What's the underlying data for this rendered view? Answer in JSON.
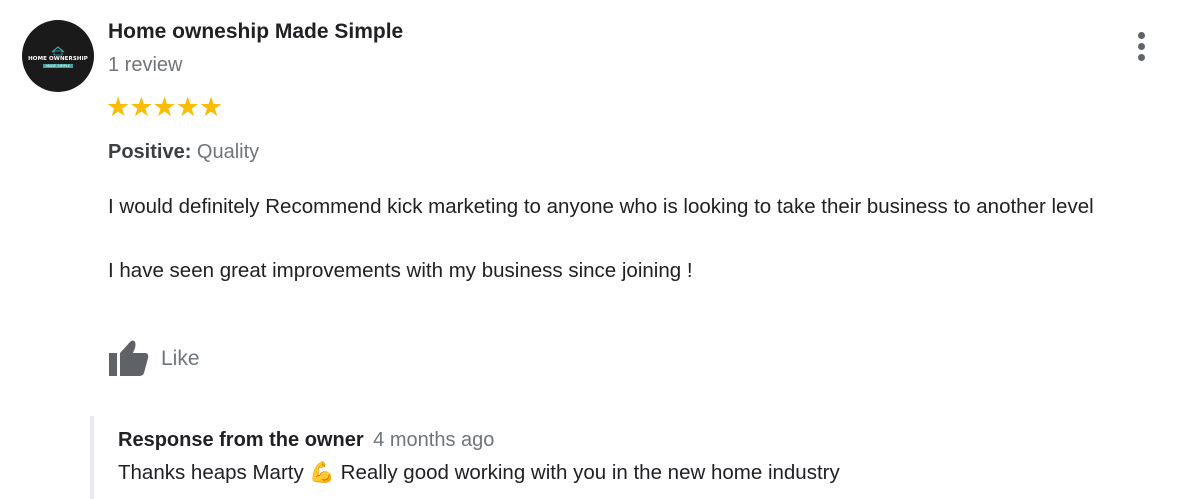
{
  "reviewer": {
    "name": "Home owneship Made Simple",
    "review_count": "1 review",
    "avatar_logo_text": "HOME OWNERSHIP",
    "avatar_logo_subtext": "MADE SIMPLE"
  },
  "rating": {
    "stars": 5,
    "max": 5,
    "star_glyphs": "★★★★★",
    "color": "#fbbc04"
  },
  "positive": {
    "label": "Positive:",
    "value": "Quality"
  },
  "review": {
    "paragraph_1": "I would definitely Recommend kick marketing to anyone who is looking to take their business to another level",
    "paragraph_2": "I have seen great improvements with my business since joining !"
  },
  "actions": {
    "like_label": "Like",
    "like_icon": "thumbs-up-icon",
    "more_icon": "more-vert-icon"
  },
  "owner_response": {
    "title": "Response from the owner",
    "time": "4 months ago",
    "text": "Thanks heaps Marty 💪 Really good working with you in the new home industry"
  },
  "colors": {
    "primary_text": "#202124",
    "secondary_text": "#70757a",
    "icon_gray": "#5f6368",
    "star_gold": "#fbbc04",
    "response_border": "#e8eaed"
  }
}
